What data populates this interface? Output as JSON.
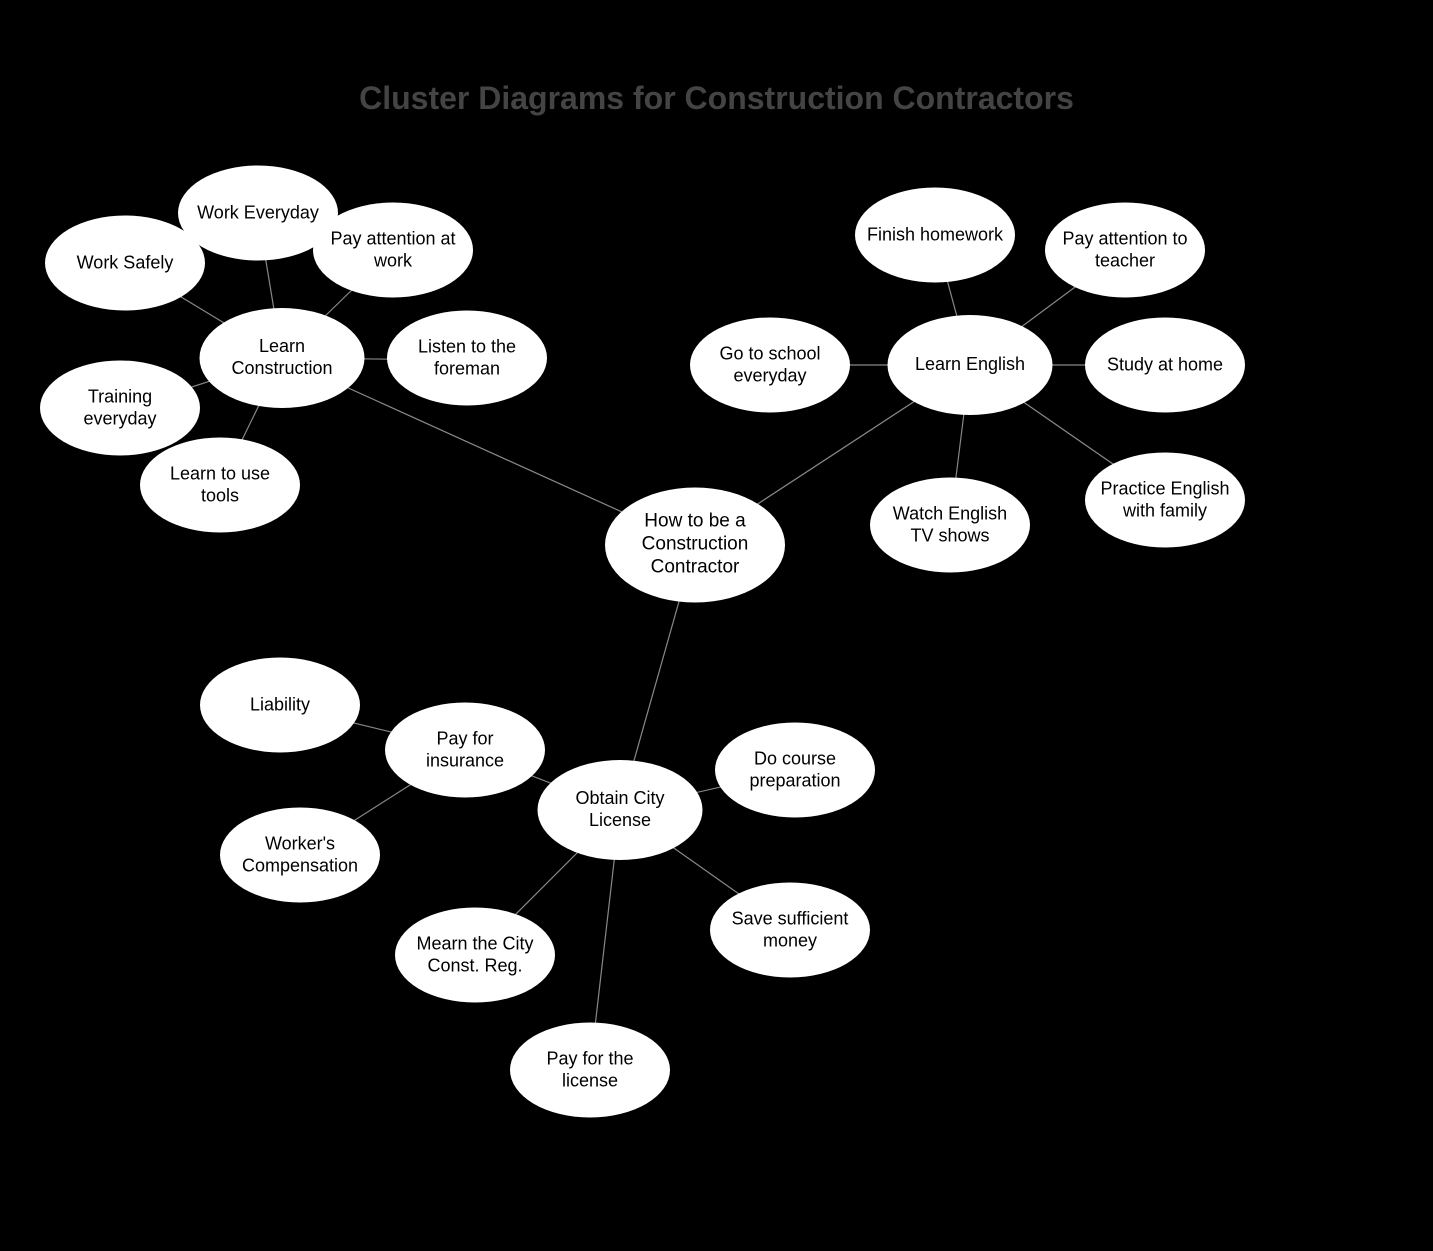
{
  "title": "Cluster Diagrams for Construction Contractors",
  "nodes": {
    "center": "How to be a Construction Contractor",
    "learn_construction": "Learn Construction",
    "work_everyday": "Work Everyday",
    "work_safely": "Work Safely",
    "pay_attention_work": "Pay attention at work",
    "listen_foreman": "Listen to the foreman",
    "training_everyday": "Training everyday",
    "learn_tools": "Learn to use tools",
    "learn_english": "Learn English",
    "finish_homework": "Finish homework",
    "pay_attention_teacher": "Pay attention to teacher",
    "study_home": "Study at home",
    "go_school": "Go to school everyday",
    "watch_tv": "Watch English TV shows",
    "practice_family": "Practice English with family",
    "obtain_license": "Obtain City License",
    "pay_insurance": "Pay for insurance",
    "liability": "Liability",
    "workers_comp": "Worker's Compensation",
    "do_course": "Do course preparation",
    "save_money": "Save sufficient money",
    "mearn_city": "Mearn the City Const. Reg.",
    "pay_license": "Pay for the license"
  }
}
